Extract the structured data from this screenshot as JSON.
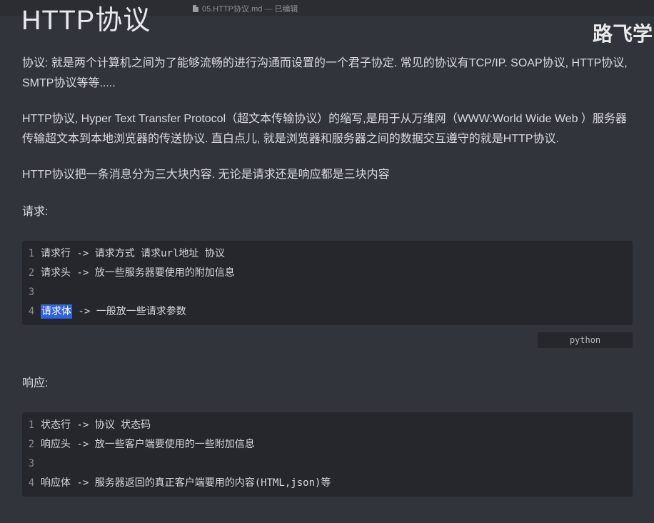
{
  "titlebar": {
    "filename": "05.HTTP协议.md",
    "separator": "—",
    "status": "已编辑"
  },
  "watermark": "路飞学",
  "heading": "HTTP协议",
  "paragraphs": {
    "p1": "协议: 就是两个计算机之间为了能够流畅的进行沟通而设置的一个君子协定. 常见的协议有TCP/IP. SOAP协议, HTTP协议, SMTP协议等等.....",
    "p2": "HTTP协议, Hyper Text Transfer Protocol（超文本传输协议）的缩写,是用于从万维网（WWW:World Wide Web ）服务器传输超文本到本地浏览器的传送协议. 直白点儿, 就是浏览器和服务器之间的数据交互遵守的就是HTTP协议.",
    "p3": "HTTP协议把一条消息分为三大块内容. 无论是请求还是响应都是三块内容",
    "p4": "请求:",
    "p5": "响应:"
  },
  "request_code": {
    "language": "python",
    "lines": [
      {
        "num": "1",
        "text": "请求行 -> 请求方式 请求url地址 协议"
      },
      {
        "num": "2",
        "text": "请求头 -> 放一些服务器要使用的附加信息"
      },
      {
        "num": "3",
        "text": ""
      },
      {
        "num": "4",
        "selected": "请求体",
        "text": " -> 一般放一些请求参数"
      }
    ]
  },
  "response_code": {
    "lines": [
      {
        "num": "1",
        "text": "状态行 -> 协议 状态码"
      },
      {
        "num": "2",
        "text": "响应头 -> 放一些客户端要使用的一些附加信息"
      },
      {
        "num": "3",
        "text": ""
      },
      {
        "num": "4",
        "text": "响应体 -> 服务器返回的真正客户端要用的内容(HTML,json)等"
      }
    ]
  },
  "colors": {
    "background": "#32343c",
    "code_background": "#25272c",
    "selection": "#2f63d6"
  }
}
